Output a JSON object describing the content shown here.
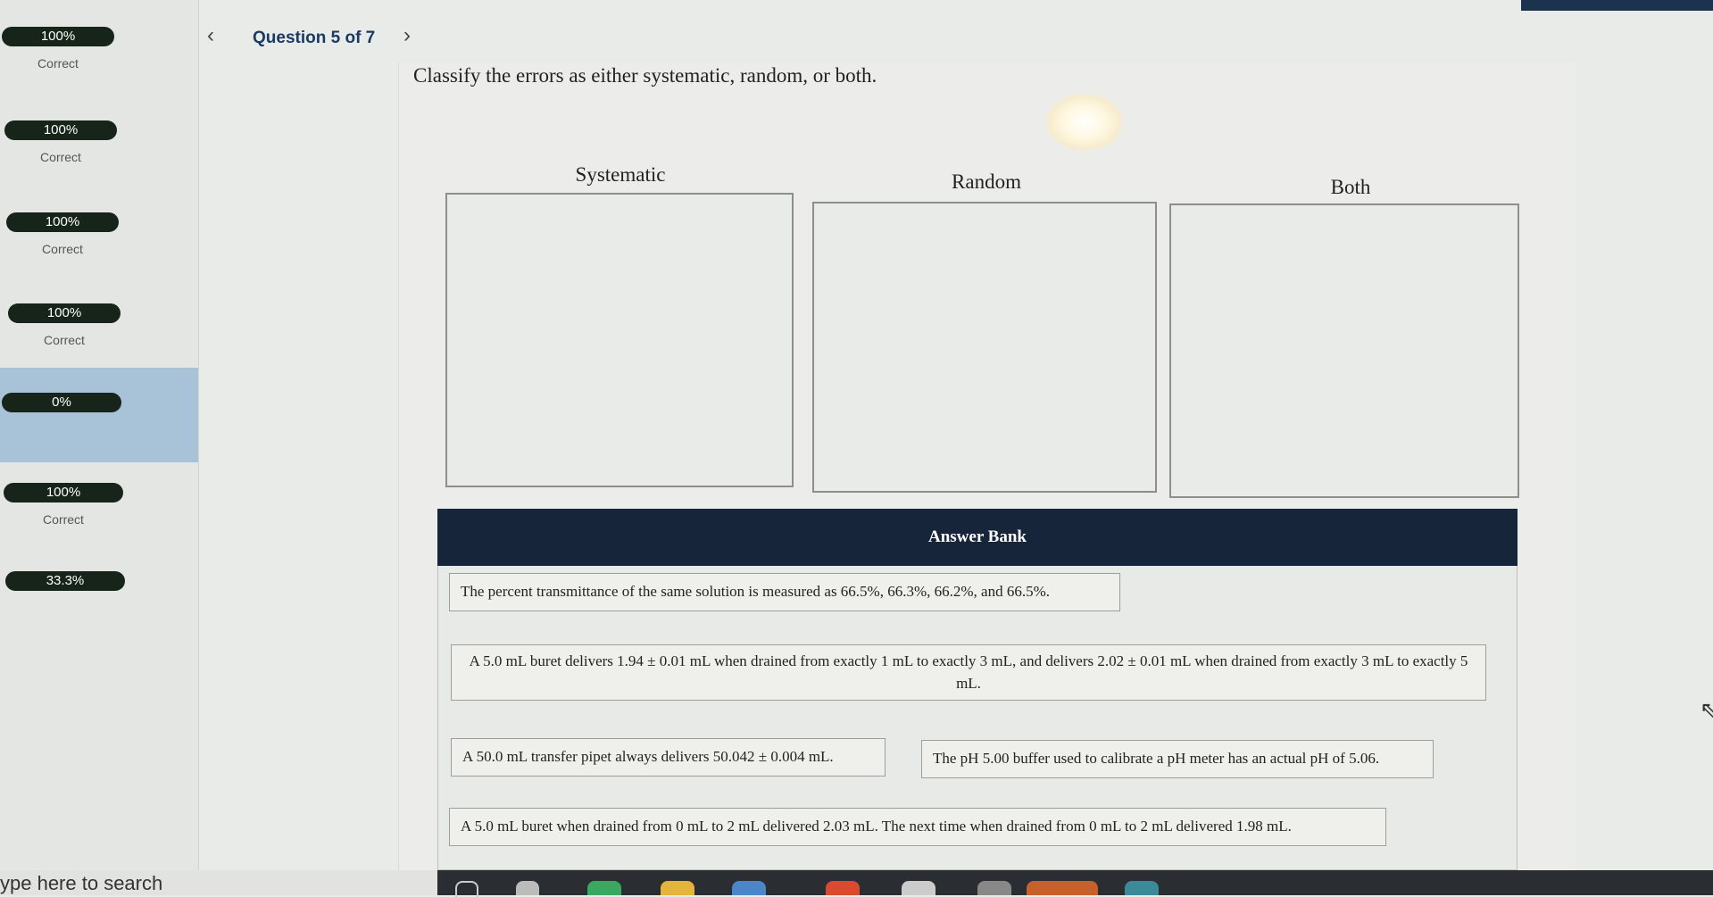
{
  "sidebar": {
    "items": [
      {
        "score": "100%",
        "status": "Correct"
      },
      {
        "score": "100%",
        "status": "Correct"
      },
      {
        "score": "100%",
        "status": "Correct"
      },
      {
        "score": "100%",
        "status": "Correct"
      },
      {
        "score": "0%",
        "status": ""
      },
      {
        "score": "100%",
        "status": "Correct"
      },
      {
        "score": "33.3%",
        "status": ""
      }
    ]
  },
  "header": {
    "prev": "‹",
    "next": "›",
    "counter": "Question 5 of 7"
  },
  "question": {
    "instruction": "Classify the errors as either systematic, random, or both."
  },
  "zones": [
    {
      "title": "Systematic"
    },
    {
      "title": "Random"
    },
    {
      "title": "Both"
    }
  ],
  "answer_bank": {
    "title": "Answer Bank",
    "items": [
      "The percent transmittance of the same solution is measured as 66.5%, 66.3%, 66.2%, and 66.5%.",
      "A 5.0 mL buret delivers 1.94 ± 0.01 mL when drained from exactly 1 mL to exactly 3 mL, and delivers 2.02 ± 0.01 mL when drained from exactly 3 mL to exactly 5 mL.",
      "A 50.0 mL transfer pipet always delivers 50.042 ± 0.004 mL.",
      "The pH 5.00 buffer used to calibrate a pH meter has an actual pH of 5.06.",
      "A 5.0 mL buret when drained from 0 mL to 2 mL delivered 2.03 mL. The next time when drained from 0 mL to 2 mL delivered 1.98 mL."
    ]
  },
  "taskbar": {
    "search_text": "ype here to search"
  }
}
